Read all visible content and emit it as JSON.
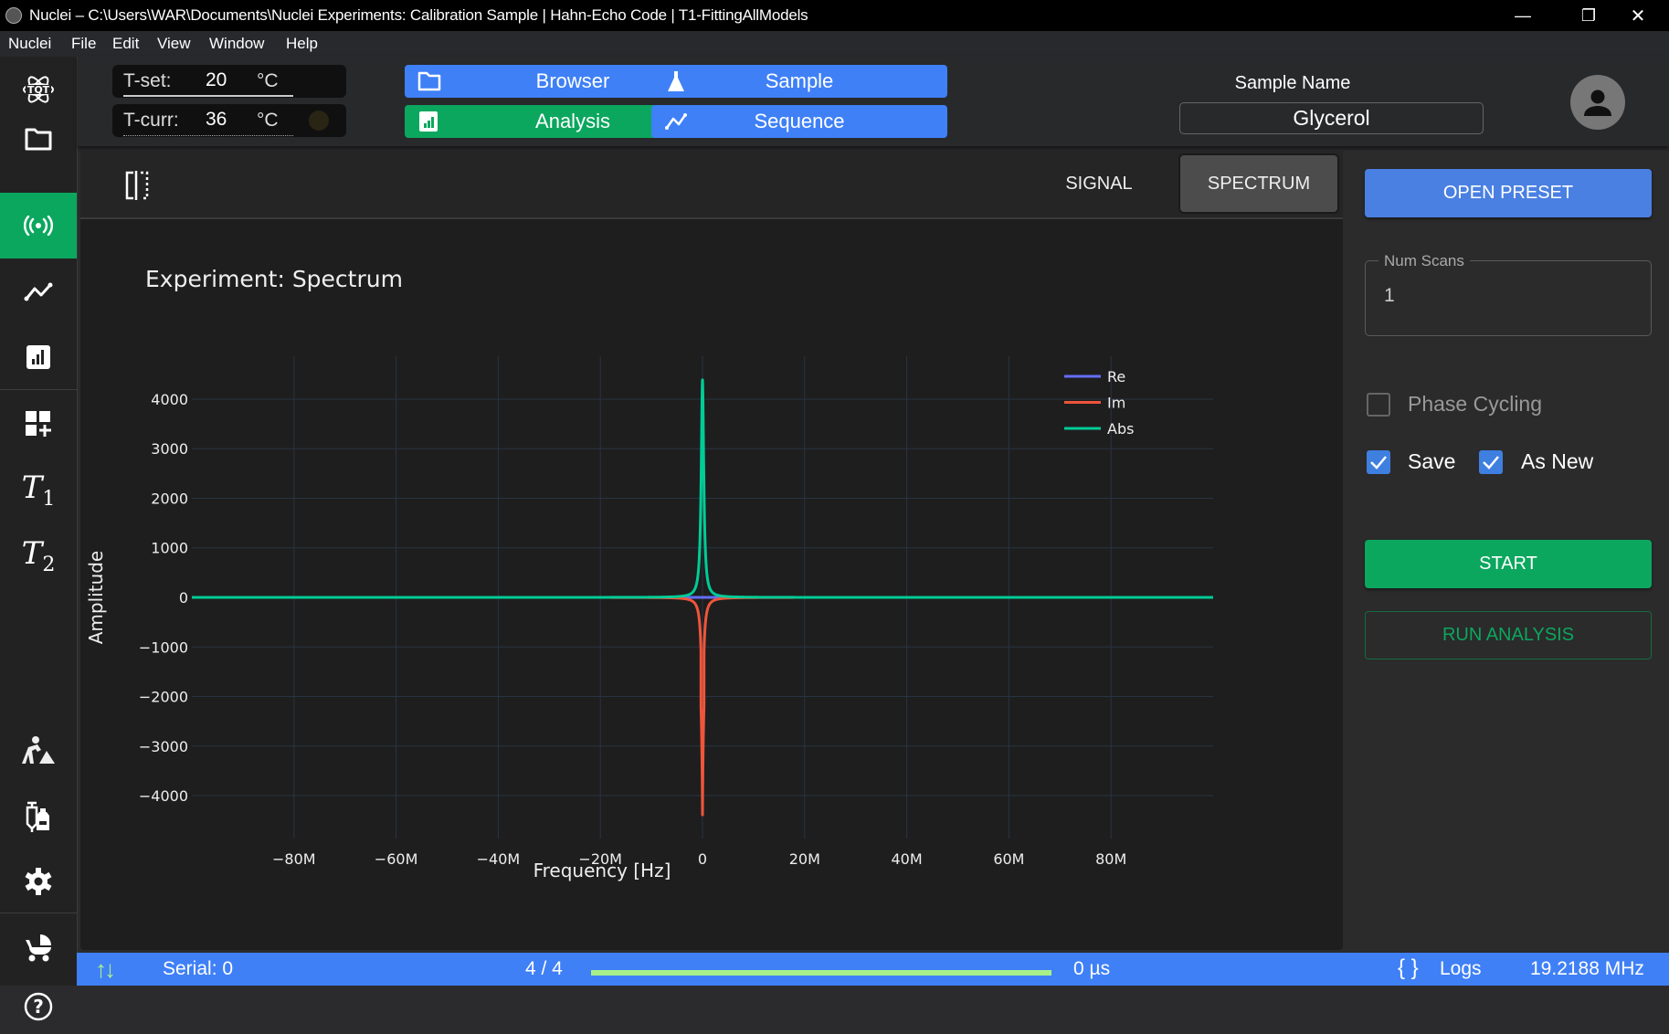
{
  "window": {
    "title": "Nuclei – C:\\Users\\WAR\\Documents\\Nuclei Experiments: Calibration Sample | Hahn-Echo Code | T1-FittingAllModels",
    "controls": {
      "minimize": "—",
      "restore": "❐",
      "close": "✕"
    }
  },
  "menu": [
    "Nuclei",
    "File",
    "Edit",
    "View",
    "Window",
    "Help"
  ],
  "sidebar": {
    "items": [
      {
        "name": "tqt-logo-icon",
        "label": "TQT"
      },
      {
        "name": "folder-icon"
      },
      {
        "name": "radio-signal-icon",
        "active": true
      },
      {
        "name": "sequence-line-icon"
      },
      {
        "name": "analysis-chart-icon"
      },
      {
        "name": "dashboard-add-icon"
      },
      {
        "name": "t1-icon",
        "label": "T",
        "sub": "1"
      },
      {
        "name": "t2-icon",
        "label": "T",
        "sub": "2"
      },
      {
        "name": "construction-worker-icon"
      },
      {
        "name": "vaccine-vial-icon"
      },
      {
        "name": "settings-gear-icon"
      },
      {
        "name": "stroller-icon"
      },
      {
        "name": "help-circle-icon",
        "label": "?"
      }
    ]
  },
  "temperature": {
    "set_label": "T-set:",
    "set_value": "20",
    "curr_label": "T-curr:",
    "curr_value": "36",
    "unit": "°C"
  },
  "nav": {
    "browser": "Browser",
    "sample": "Sample",
    "analysis": "Analysis",
    "sequence": "Sequence"
  },
  "sample": {
    "label": "Sample Name",
    "value": "Glycerol"
  },
  "toolbar": {
    "tabs": [
      {
        "label": "SIGNAL",
        "selected": false
      },
      {
        "label": "SPECTRUM",
        "selected": true
      }
    ]
  },
  "controls": {
    "open_preset": "OPEN PRESET",
    "num_scans_label": "Num Scans",
    "num_scans_value": "1",
    "phase_cycling_label": "Phase Cycling",
    "phase_cycling_checked": false,
    "save_label": "Save",
    "save_checked": true,
    "as_new_label": "As New",
    "as_new_checked": true,
    "start": "START",
    "run_analysis": "RUN ANALYSIS"
  },
  "status": {
    "serial": "Serial: 0",
    "progress_text": "4 / 4",
    "progress_fraction": 1.0,
    "time": "0 µs",
    "logs": "Logs",
    "frequency": "19.2188 MHz"
  },
  "colors": {
    "accent_blue": "#3f80f6",
    "accent_green": "#0ba75e",
    "progress": "#a8f08a",
    "re": "#636efa",
    "im": "#ef553b",
    "abs": "#00cc96"
  },
  "chart_data": {
    "type": "line",
    "title": "Experiment: Spectrum",
    "xlabel": "Frequency [Hz]",
    "ylabel": "Amplitude",
    "xlim": [
      -100000000,
      100000000
    ],
    "ylim": [
      -4866,
      4866
    ],
    "x_ticks": [
      -80000000,
      -60000000,
      -40000000,
      -20000000,
      0,
      20000000,
      40000000,
      60000000,
      80000000
    ],
    "x_tick_labels": [
      "−80M",
      "−60M",
      "−40M",
      "−20M",
      "0",
      "20M",
      "40M",
      "60M",
      "80M"
    ],
    "y_ticks": [
      -4000,
      -3000,
      -2000,
      -1000,
      0,
      1000,
      2000,
      3000,
      4000
    ],
    "y_tick_labels": [
      "−4000",
      "−3000",
      "−2000",
      "−1000",
      "0",
      "1000",
      "2000",
      "3000",
      "4000"
    ],
    "grid": true,
    "legend_position": "top-right",
    "series": [
      {
        "name": "Re",
        "peak": {
          "x": 0,
          "y": 0
        },
        "shape": "flat",
        "width_hz": 300000
      },
      {
        "name": "Im",
        "peak": {
          "x": 0,
          "y": -4390
        },
        "shape": "dispersive",
        "width_hz": 300000
      },
      {
        "name": "Abs",
        "peak": {
          "x": 0,
          "y": 4390
        },
        "shape": "lorentzian",
        "width_hz": 300000
      }
    ]
  }
}
